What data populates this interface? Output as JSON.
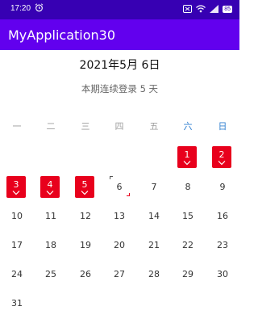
{
  "status_bar": {
    "time": "17:20",
    "battery": "85"
  },
  "app_bar": {
    "title": "MyApplication30"
  },
  "calendar": {
    "date_title": "2021年5月 6日",
    "streak_text": "本期连续登录 5 天",
    "weekdays": [
      "一",
      "二",
      "三",
      "四",
      "五",
      "六",
      "日"
    ],
    "colors": {
      "primary_dark": "#3700B3",
      "primary": "#6200EE",
      "signed": "#e8001c",
      "weekend": "#2f7fd0"
    },
    "weeks": [
      [
        null,
        null,
        null,
        null,
        null,
        {
          "day": "1",
          "signed": true
        },
        {
          "day": "2",
          "signed": true
        }
      ],
      [
        {
          "day": "3",
          "signed": true
        },
        {
          "day": "4",
          "signed": true
        },
        {
          "day": "5",
          "signed": true
        },
        {
          "day": "6",
          "today": true
        },
        {
          "day": "7"
        },
        {
          "day": "8"
        },
        {
          "day": "9"
        }
      ],
      [
        {
          "day": "10"
        },
        {
          "day": "11"
        },
        {
          "day": "12"
        },
        {
          "day": "13"
        },
        {
          "day": "14"
        },
        {
          "day": "15"
        },
        {
          "day": "16"
        }
      ],
      [
        {
          "day": "17"
        },
        {
          "day": "18"
        },
        {
          "day": "19"
        },
        {
          "day": "20"
        },
        {
          "day": "21"
        },
        {
          "day": "22"
        },
        {
          "day": "23"
        }
      ],
      [
        {
          "day": "24"
        },
        {
          "day": "25"
        },
        {
          "day": "26"
        },
        {
          "day": "27"
        },
        {
          "day": "28"
        },
        {
          "day": "29"
        },
        {
          "day": "30"
        }
      ],
      [
        {
          "day": "31"
        },
        null,
        null,
        null,
        null,
        null,
        null
      ]
    ]
  }
}
